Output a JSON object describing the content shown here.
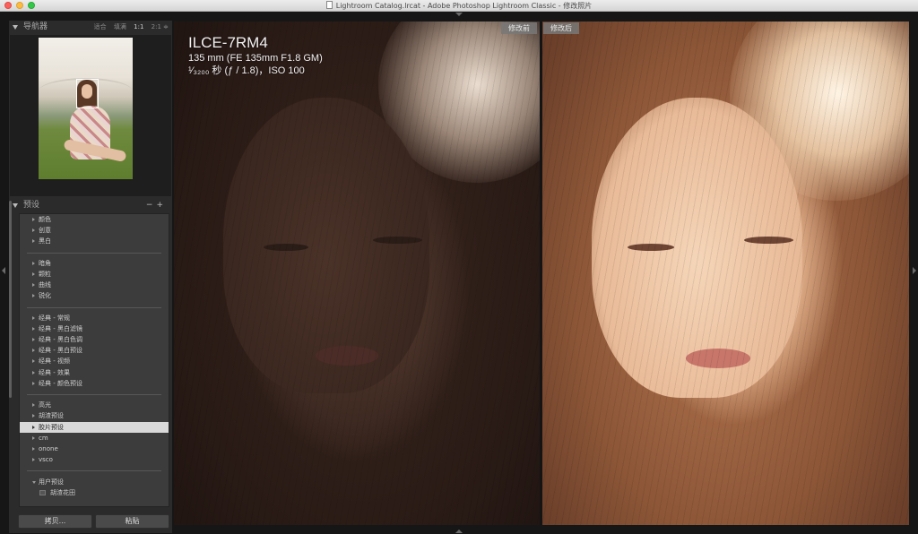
{
  "window": {
    "title": "Lightroom Catalog.lrcat - Adobe Photoshop Lightroom Classic - 修改照片"
  },
  "navigator": {
    "title": "导航器",
    "options": [
      "适合",
      "填满",
      "1:1",
      "2:1 ≑"
    ],
    "selected_option": "1:1"
  },
  "presets": {
    "title": "预设",
    "controls": "−+",
    "groups": [
      [
        "颜色",
        "创意",
        "黑白"
      ],
      [
        "暗角",
        "颗粒",
        "曲线",
        "锐化"
      ],
      [
        "经典 - 常规",
        "经典 - 黑白滤镜",
        "经典 - 黑白色调",
        "经典 - 黑白预设",
        "经典 - 视频",
        "经典 - 效果",
        "经典 - 颜色预设"
      ],
      [
        "高光",
        "胡渣预设",
        "胶片预设",
        "cm",
        "onone",
        "vsco"
      ]
    ],
    "selected": "胶片预设",
    "user_group": "用户预设",
    "user_items": [
      "胡渣花田"
    ]
  },
  "buttons": {
    "copy": "拷贝...",
    "paste": "粘贴"
  },
  "photo_info": {
    "camera": "ILCE-7RM4",
    "lens": "135 mm (FE 135mm F1.8 GM)",
    "exposure": "¹⁄₃₂₀₀ 秒 (ƒ / 1.8)，ISO 100"
  },
  "compare": {
    "before_label": "修改前",
    "after_label": "修改后"
  },
  "colors": {
    "panel": "#2b2b2b",
    "list": "#3c3c3c",
    "selected_row": "#d9d9d9",
    "background": "#161616"
  }
}
